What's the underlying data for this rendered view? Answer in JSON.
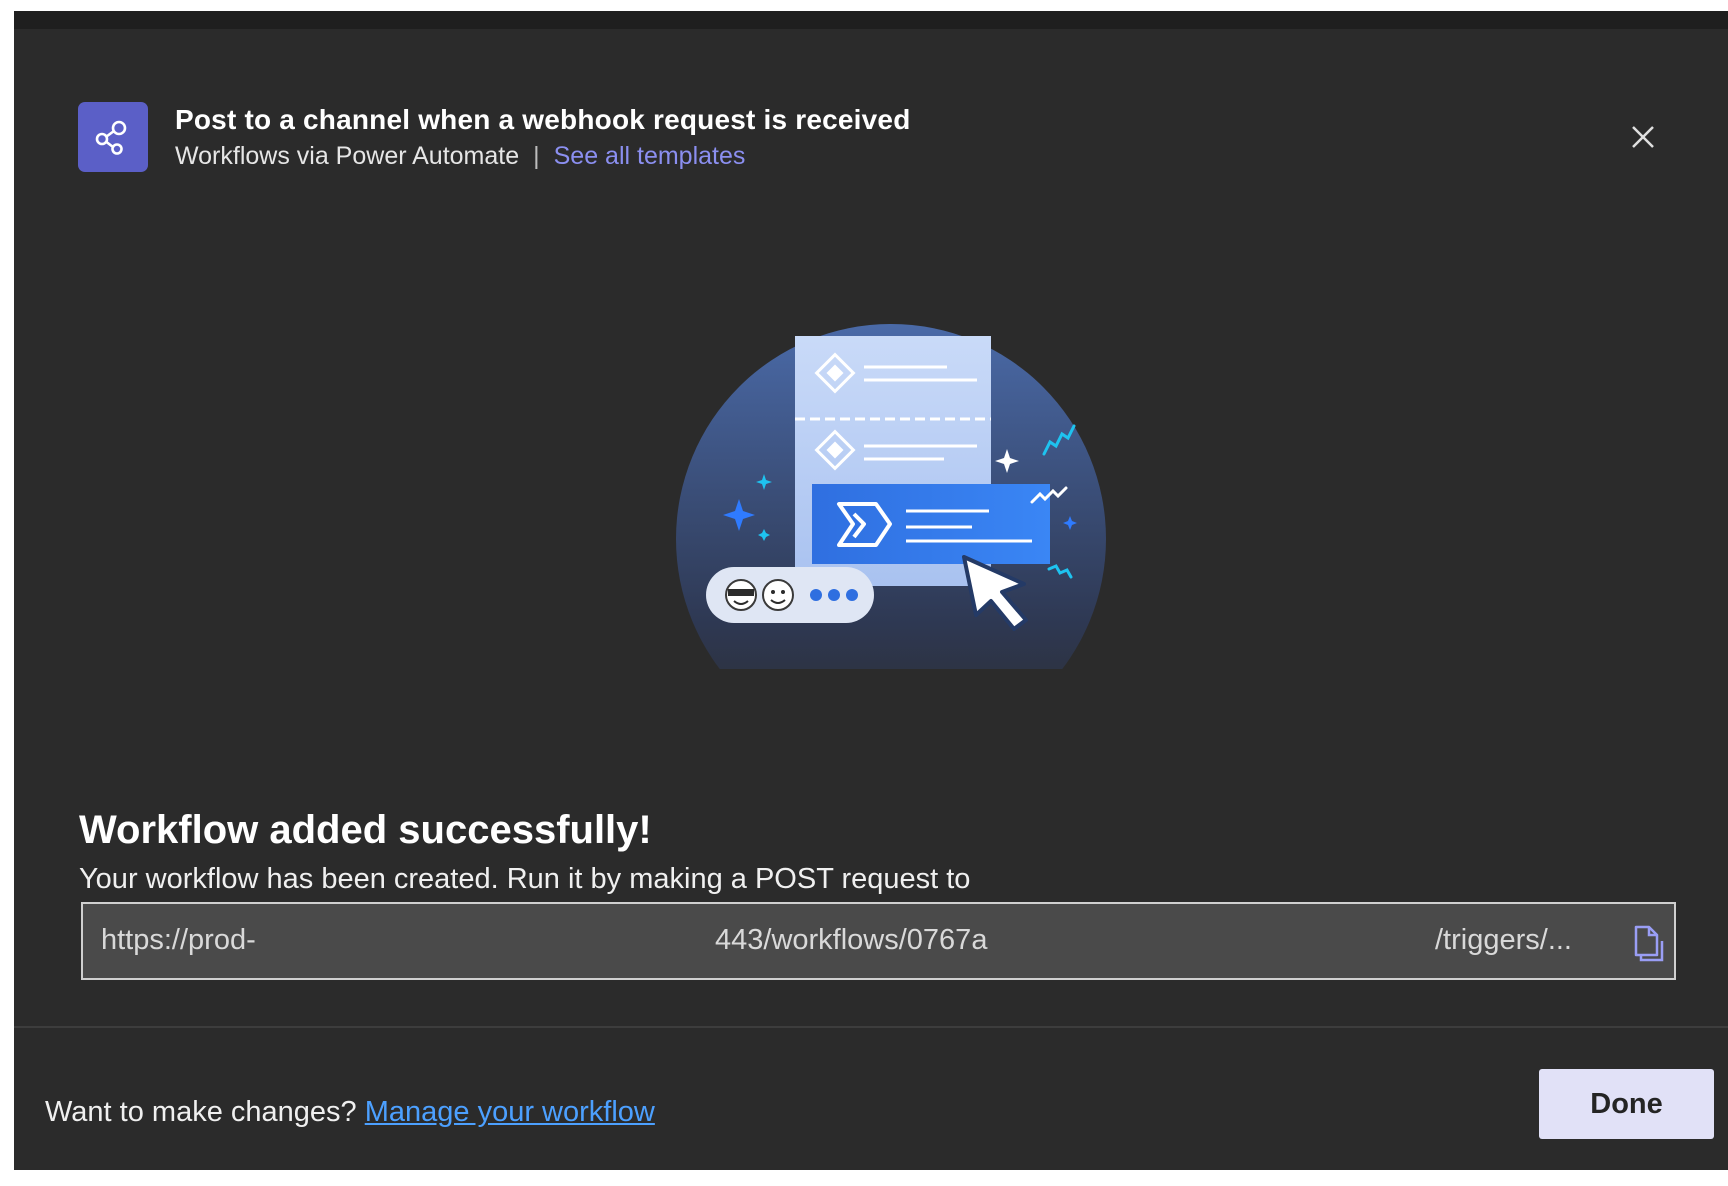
{
  "header": {
    "title": "Post to a channel when a webhook request is received",
    "source": "Workflows via Power Automate",
    "separator": "|",
    "templates_link": "See all templates"
  },
  "icons": {
    "app": "share-nodes-icon",
    "close": "close-icon",
    "copy": "copy-icon"
  },
  "success": {
    "title": "Workflow added successfully!",
    "description": "Your workflow has been created. Run it by making a POST request to"
  },
  "url": {
    "part1": "https://prod-",
    "part2": "443/workflows/0767a",
    "part3": "/triggers/..."
  },
  "footer": {
    "prompt": "Want to make changes?",
    "manage_link": "Manage your workflow",
    "done_label": "Done"
  },
  "colors": {
    "dialog_bg": "#2b2b2b",
    "accent": "#5b5fc7",
    "link": "#8b8ff0",
    "manage_link": "#4ca0ff",
    "done_bg": "#e1e1f7"
  }
}
